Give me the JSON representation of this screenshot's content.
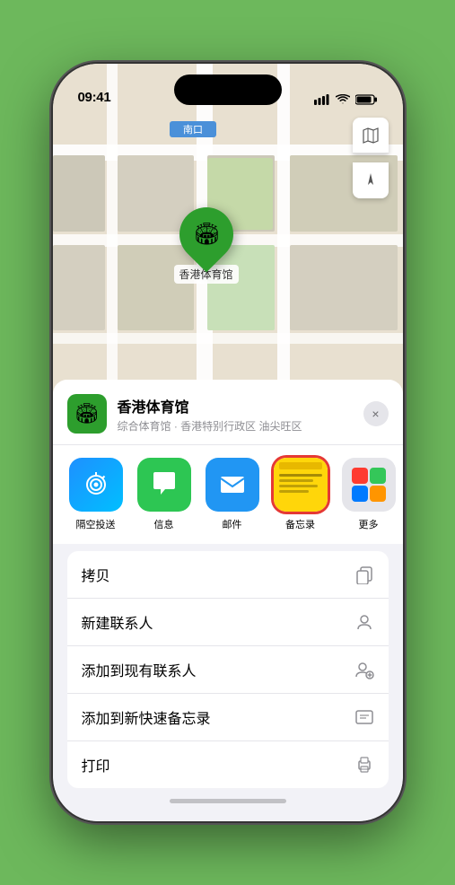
{
  "status_bar": {
    "time": "09:41",
    "signal": "●●●●",
    "wifi": "WiFi",
    "battery": "Bat"
  },
  "map": {
    "station_label": "南口",
    "pin_label": "香港体育馆",
    "controls": {
      "map_type": "🗺",
      "location": "➤"
    }
  },
  "sheet": {
    "venue_name": "香港体育馆",
    "venue_desc": "综合体育馆 · 香港特别行政区 油尖旺区",
    "close_label": "×"
  },
  "share_items": [
    {
      "id": "airdrop",
      "label": "隔空投送",
      "type": "airdrop"
    },
    {
      "id": "messages",
      "label": "信息",
      "type": "messages"
    },
    {
      "id": "mail",
      "label": "邮件",
      "type": "mail"
    },
    {
      "id": "notes",
      "label": "备忘录",
      "type": "notes"
    },
    {
      "id": "more",
      "label": "更多",
      "type": "more"
    }
  ],
  "actions": [
    {
      "id": "copy",
      "label": "拷贝",
      "icon": "📋"
    },
    {
      "id": "new-contact",
      "label": "新建联系人",
      "icon": "👤"
    },
    {
      "id": "add-contact",
      "label": "添加到现有联系人",
      "icon": "👤"
    },
    {
      "id": "quick-note",
      "label": "添加到新快速备忘录",
      "icon": "📝"
    },
    {
      "id": "print",
      "label": "打印",
      "icon": "🖨"
    }
  ],
  "home_indicator": ""
}
